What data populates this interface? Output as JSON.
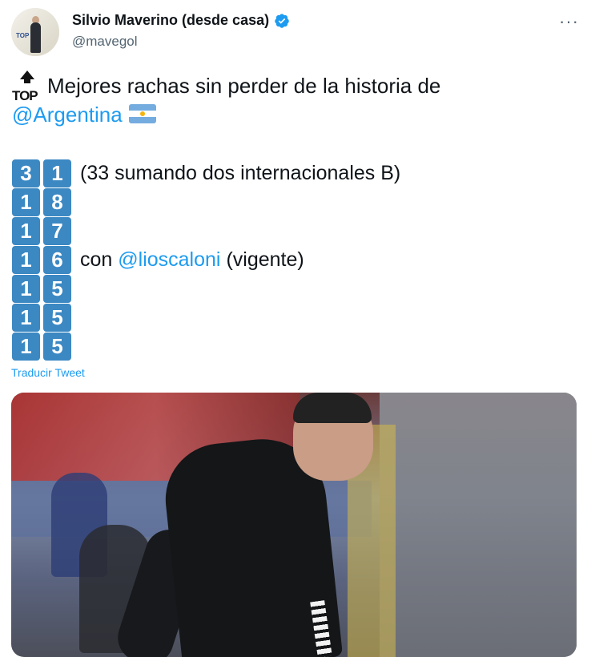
{
  "author": {
    "name": "Silvio Maverino (desde casa)",
    "handle": "@mavegol"
  },
  "tweet": {
    "line1": "Mejores rachas sin perder de la historia de",
    "mention_country": "@Argentina",
    "streaks": [
      {
        "digits": [
          "3",
          "1"
        ],
        "note": "(33 sumando dos internacionales B)"
      },
      {
        "digits": [
          "1",
          "8"
        ]
      },
      {
        "digits": [
          "1",
          "7"
        ]
      },
      {
        "digits": [
          "1",
          "6"
        ],
        "note_prefix": "con",
        "note_mention": "@lioscaloni",
        "note_suffix": "(vigente)"
      },
      {
        "digits": [
          "1",
          "5"
        ]
      },
      {
        "digits": [
          "1",
          "5"
        ]
      },
      {
        "digits": [
          "1",
          "5"
        ]
      }
    ]
  },
  "translate_label": "Traducir Tweet",
  "icons": {
    "verified": "verified-badge-icon",
    "more": "more-options-icon",
    "top_emoji": "top-arrow-icon",
    "flag": "argentina-flag-icon"
  },
  "colors": {
    "link": "#1d9bf0",
    "keycap": "#3b88c3",
    "secondary_text": "#536471"
  }
}
